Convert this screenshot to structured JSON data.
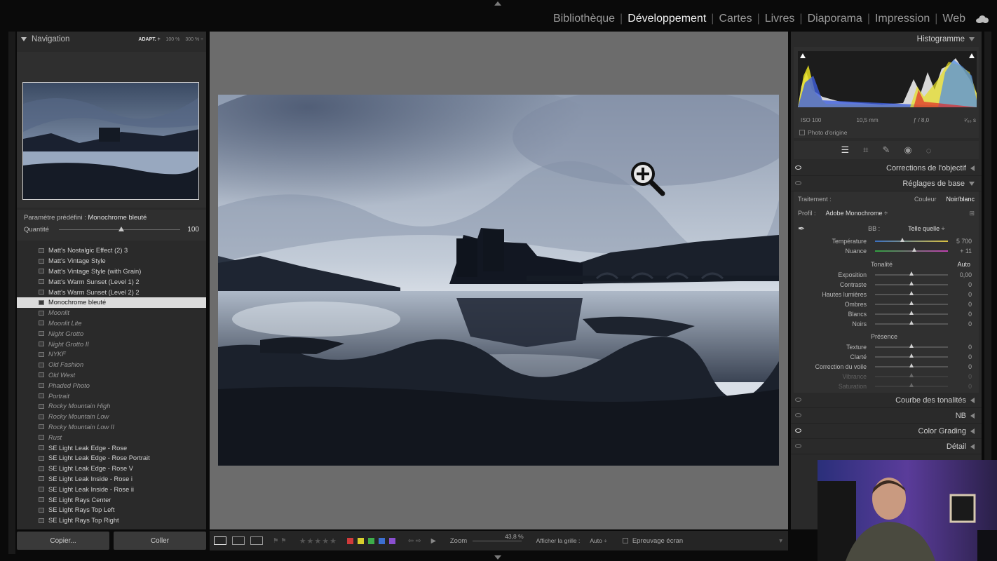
{
  "modules": [
    "Bibliothèque",
    "Développement",
    "Cartes",
    "Livres",
    "Diaporama",
    "Impression",
    "Web"
  ],
  "active_module": "Développement",
  "left_panel": {
    "navigator_title": "Navigation",
    "zoom_options": [
      "ADAPT. ÷",
      "100 %",
      "300 % ÷"
    ],
    "preset_label": "Paramètre prédéfini :",
    "preset_name": "Monochrome bleuté",
    "amount_label": "Quantité",
    "amount_value": "100",
    "presets": [
      {
        "name": "Matt's Nostalgic Effect (2) 3",
        "dim": false,
        "selected": false
      },
      {
        "name": "Matt's Vintage Style",
        "dim": false,
        "selected": false
      },
      {
        "name": "Matt's Vintage Style (with Grain)",
        "dim": false,
        "selected": false
      },
      {
        "name": "Matt's Warm Sunset (Level 1) 2",
        "dim": false,
        "selected": false
      },
      {
        "name": "Matt's Warm Sunset (Level 2) 2",
        "dim": false,
        "selected": false
      },
      {
        "name": "Monochrome bleuté",
        "dim": false,
        "selected": true
      },
      {
        "name": "Moonlit",
        "dim": true,
        "selected": false
      },
      {
        "name": "Moonlit Lite",
        "dim": true,
        "selected": false
      },
      {
        "name": "Night Grotto",
        "dim": true,
        "selected": false
      },
      {
        "name": "Night Grotto II",
        "dim": true,
        "selected": false
      },
      {
        "name": "NYKF",
        "dim": true,
        "selected": false
      },
      {
        "name": "Old Fashion",
        "dim": true,
        "selected": false
      },
      {
        "name": "Old West",
        "dim": true,
        "selected": false
      },
      {
        "name": "Phaded Photo",
        "dim": true,
        "selected": false
      },
      {
        "name": "Portrait",
        "dim": true,
        "selected": false
      },
      {
        "name": "Rocky Mountain High",
        "dim": true,
        "selected": false
      },
      {
        "name": "Rocky Mountain Low",
        "dim": true,
        "selected": false
      },
      {
        "name": "Rocky Mountain Low II",
        "dim": true,
        "selected": false
      },
      {
        "name": "Rust",
        "dim": true,
        "selected": false
      },
      {
        "name": "SE Light Leak Edge - Rose",
        "dim": false,
        "selected": false
      },
      {
        "name": "SE Light Leak Edge - Rose Portrait",
        "dim": false,
        "selected": false
      },
      {
        "name": "SE Light Leak Edge - Rose V",
        "dim": false,
        "selected": false
      },
      {
        "name": "SE Light Leak Inside - Rose i",
        "dim": false,
        "selected": false
      },
      {
        "name": "SE Light Leak Inside - Rose ii",
        "dim": false,
        "selected": false
      },
      {
        "name": "SE Light Rays Center",
        "dim": false,
        "selected": false
      },
      {
        "name": "SE Light Rays Top Left",
        "dim": false,
        "selected": false
      },
      {
        "name": "SE Light Rays Top Right",
        "dim": false,
        "selected": false
      }
    ],
    "copy_button": "Copier...",
    "paste_button": "Coller"
  },
  "toolbar": {
    "zoom_label": "Zoom",
    "zoom_value": "43,8 %",
    "grid_label": "Afficher la grille :",
    "grid_value": "Auto ÷",
    "softproof_label": "Epreuvage écran",
    "color_labels": [
      "#d03a3a",
      "#d8cf2d",
      "#3dad4a",
      "#3c6fd0",
      "#8a4fd0"
    ]
  },
  "right_panel": {
    "histogram_title": "Histogramme",
    "iso": "ISO 100",
    "focal": "10,5 mm",
    "aperture": "ƒ / 8,0",
    "shutter": "¹⁄₆₀ s",
    "original_photo": "Photo d'origine",
    "sections_top": [
      "Corrections de l'objectif"
    ],
    "basic_title": "Réglages de base",
    "treatment_label": "Traitement :",
    "treatment_color": "Couleur",
    "treatment_bw": "Noir/blanc",
    "profile_label": "Profil :",
    "profile_value": "Adobe Monochrome ÷",
    "wb_label": "BB :",
    "wb_value": "Telle quelle ÷",
    "temp": {
      "label": "Température",
      "value": "5 700",
      "pos": 0.38
    },
    "tint": {
      "label": "Nuance",
      "value": "+ 11",
      "pos": 0.54
    },
    "tone_title": "Tonalité",
    "auto_label": "Auto",
    "tone_sliders": [
      {
        "label": "Exposition",
        "value": "0,00",
        "pos": 0.5
      },
      {
        "label": "Contraste",
        "value": "0",
        "pos": 0.5
      },
      {
        "label": "Hautes lumières",
        "value": "0",
        "pos": 0.5
      },
      {
        "label": "Ombres",
        "value": "0",
        "pos": 0.5
      },
      {
        "label": "Blancs",
        "value": "0",
        "pos": 0.5
      },
      {
        "label": "Noirs",
        "value": "0",
        "pos": 0.5
      }
    ],
    "presence_title": "Présence",
    "presence_sliders": [
      {
        "label": "Texture",
        "value": "0",
        "pos": 0.5
      },
      {
        "label": "Clarté",
        "value": "0",
        "pos": 0.5
      },
      {
        "label": "Correction du voile",
        "value": "0",
        "pos": 0.5
      },
      {
        "label": "Vibrance",
        "value": "0",
        "pos": 0.5,
        "dim": true
      },
      {
        "label": "Saturation",
        "value": "0",
        "pos": 0.5,
        "dim": true
      }
    ],
    "sections_bottom": [
      {
        "label": "Courbe des tonalités",
        "eye_on": false
      },
      {
        "label": "NB",
        "eye_on": false
      },
      {
        "label": "Color Grading",
        "eye_on": true
      },
      {
        "label": "Détail",
        "eye_on": false
      }
    ]
  }
}
